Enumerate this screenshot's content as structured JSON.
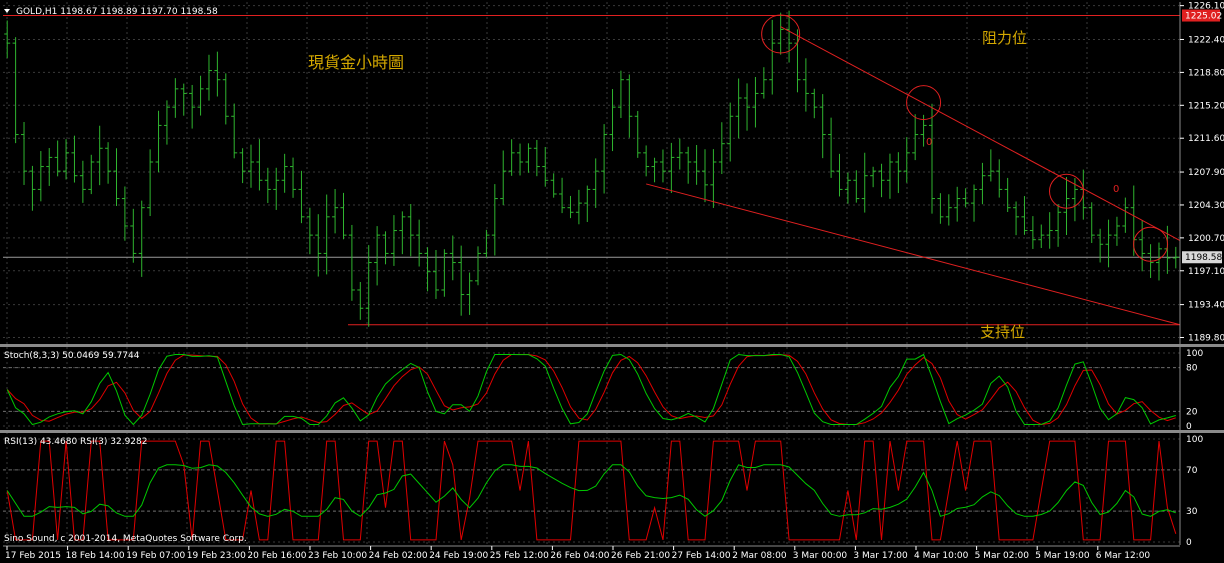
{
  "header": {
    "main_title": "GOLD,H1  1198.67 1198.89 1197.70 1198.58",
    "stoch_title": "Stoch(8,3,3) 50.0469 59.7744",
    "rsi_title": "RSI(13) 43.4680  RSI(3) 32.9282",
    "copyright": "Sino Sound, c 2001-2014, MetaQuotes Software Corp."
  },
  "annotations": {
    "chinese_title": "現貨金小時圖",
    "resistance": "阻力位",
    "support": "支持位",
    "marker_label": "0"
  },
  "colors": {
    "background": "#000000",
    "grid": "#3a3a3a",
    "candles": "#2fb52f",
    "trendline": "#e02020",
    "annotation_text": "#d4a800",
    "stoch_main": "#00c800",
    "stoch_signal": "#e00000",
    "rsi_fast": "#e00000",
    "rsi_slow": "#00c800",
    "axis_text": "#ffffff",
    "current_price_box": "#d8d8d8",
    "resistance_price_box": "#e02020"
  },
  "chart_data": [
    {
      "type": "candlestick",
      "title": "GOLD,H1",
      "ohlc_last": {
        "open": 1198.67,
        "high": 1198.89,
        "low": 1197.7,
        "close": 1198.58
      },
      "y_ticks": [
        "1226.10",
        "1222.40",
        "1218.80",
        "1215.20",
        "1211.60",
        "1207.90",
        "1204.30",
        "1200.70",
        "1197.10",
        "1193.40",
        "1189.80"
      ],
      "ylim": [
        1189.2,
        1226.5
      ],
      "current_price": "1198.58",
      "resistance_price": "1225.02",
      "horizontal_lines": [
        1225.02,
        1191.2
      ],
      "x_tick_labels": [
        "17 Feb 2015",
        "18 Feb 14:00",
        "19 Feb 07:00",
        "19 Feb 23:00",
        "20 Feb 16:00",
        "23 Feb 10:00",
        "24 Feb 02:00",
        "24 Feb 19:00",
        "25 Feb 12:00",
        "26 Feb 04:00",
        "26 Feb 21:00",
        "27 Feb 14:00",
        "2 Mar 08:00",
        "3 Mar 00:00",
        "3 Mar 17:00",
        "4 Mar 10:00",
        "5 Mar 02:00",
        "5 Mar 19:00",
        "6 Mar 12:00"
      ],
      "closes": [
        1222.0,
        1212.0,
        1208.0,
        1206.0,
        1208.5,
        1209.5,
        1208.0,
        1210.0,
        1207.5,
        1206.0,
        1209.0,
        1210.5,
        1208.0,
        1205.0,
        1202.0,
        1199.0,
        1204.0,
        1209.0,
        1213.0,
        1215.0,
        1217.0,
        1216.5,
        1215.0,
        1217.0,
        1219.0,
        1218.0,
        1214.0,
        1210.0,
        1208.0,
        1209.0,
        1207.0,
        1206.0,
        1207.0,
        1208.5,
        1206.0,
        1203.0,
        1201.0,
        1199.0,
        1203.0,
        1204.0,
        1201.0,
        1195.0,
        1193.0,
        1198.0,
        1201.0,
        1199.0,
        1201.5,
        1203.0,
        1201.0,
        1199.0,
        1197.0,
        1195.0,
        1199.0,
        1198.0,
        1194.5,
        1196.0,
        1199.0,
        1201.0,
        1205.0,
        1208.0,
        1210.0,
        1209.0,
        1210.5,
        1208.5,
        1207.0,
        1205.5,
        1204.0,
        1203.5,
        1204.5,
        1206.0,
        1208.0,
        1212.0,
        1215.0,
        1218.0,
        1214.0,
        1210.0,
        1208.5,
        1209.0,
        1208.0,
        1209.5,
        1210.0,
        1209.0,
        1208.0,
        1206.5,
        1209.0,
        1211.0,
        1214.0,
        1216.0,
        1215.0,
        1216.5,
        1218.0,
        1222.0,
        1223.5,
        1222.0,
        1218.0,
        1216.5,
        1215.0,
        1212.0,
        1208.0,
        1206.0,
        1207.0,
        1205.0,
        1207.5,
        1208.0,
        1207.0,
        1209.0,
        1208.0,
        1210.0,
        1212.0,
        1213.0,
        1205.0,
        1203.0,
        1204.0,
        1205.0,
        1204.5,
        1206.0,
        1207.5,
        1208.0,
        1206.0,
        1204.0,
        1203.0,
        1201.5,
        1200.5,
        1201.0,
        1201.5,
        1203.5,
        1205.0,
        1206.0,
        1204.0,
        1201.0,
        1200.0,
        1201.0,
        1202.0,
        1204.0,
        1200.5,
        1199.0,
        1198.0,
        1199.5,
        1198.5,
        1198.58
      ],
      "trendlines": [
        {
          "name": "resistance",
          "from": {
            "bar": 92,
            "price": 1223.8
          },
          "to": {
            "bar": 143,
            "price": 1200.4
          }
        },
        {
          "name": "support",
          "from": {
            "bar": 76,
            "price": 1206.6
          },
          "to": {
            "bar": 143,
            "price": 1191.8
          }
        }
      ],
      "circled_points": [
        {
          "bar": 92,
          "price": 1223.0
        },
        {
          "bar": 109,
          "price": 1215.5
        },
        {
          "bar": 126,
          "price": 1205.8
        },
        {
          "bar": 136,
          "price": 1200.0
        }
      ]
    },
    {
      "type": "line",
      "title": "Stoch(8,3,3)",
      "ylim": [
        0,
        100
      ],
      "y_ticks": [
        "100",
        "80",
        "20",
        "0"
      ],
      "levels": [
        80,
        20
      ],
      "series": [
        {
          "name": "main",
          "last_value": 50.0469
        },
        {
          "name": "signal",
          "last_value": 59.7744
        }
      ]
    },
    {
      "type": "line",
      "title": "RSI",
      "ylim": [
        0,
        100
      ],
      "y_ticks": [
        "100",
        "70",
        "30",
        "0"
      ],
      "levels": [
        70,
        30
      ],
      "series": [
        {
          "name": "RSI(13)",
          "last_value": 43.468
        },
        {
          "name": "RSI(3)",
          "last_value": 32.9282
        }
      ]
    }
  ]
}
